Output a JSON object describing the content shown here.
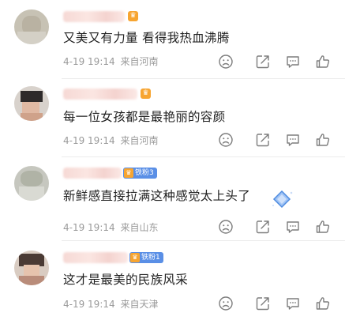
{
  "colors": {
    "divider": "#ececec",
    "meta": "#9a9a9a",
    "icon": "#7d7d7d",
    "fan_badge": "#5a8fe6"
  },
  "icons": {
    "crown": "crown-icon",
    "fan": "fan-badge-icon",
    "dislike": "dislike-icon",
    "share": "share-icon",
    "comment": "comment-icon",
    "like": "like-icon"
  },
  "comments": [
    {
      "text": "又美又有力量 看得我热血沸腾",
      "time": "4-19 19:14",
      "location": "来自河南"
    },
    {
      "text": "每一位女孩都是最艳丽的容颜",
      "time": "4-19 19:14",
      "location": "来自河南"
    },
    {
      "text": "新鲜感直接拉满这种感觉太上头了",
      "time": "4-19 19:14",
      "location": "来自山东",
      "fan_badge": "铁粉3"
    },
    {
      "text": "这才是最美的民族风采",
      "time": "4-19 19:14",
      "location": "来自天津",
      "fan_badge": "铁粉1"
    }
  ]
}
